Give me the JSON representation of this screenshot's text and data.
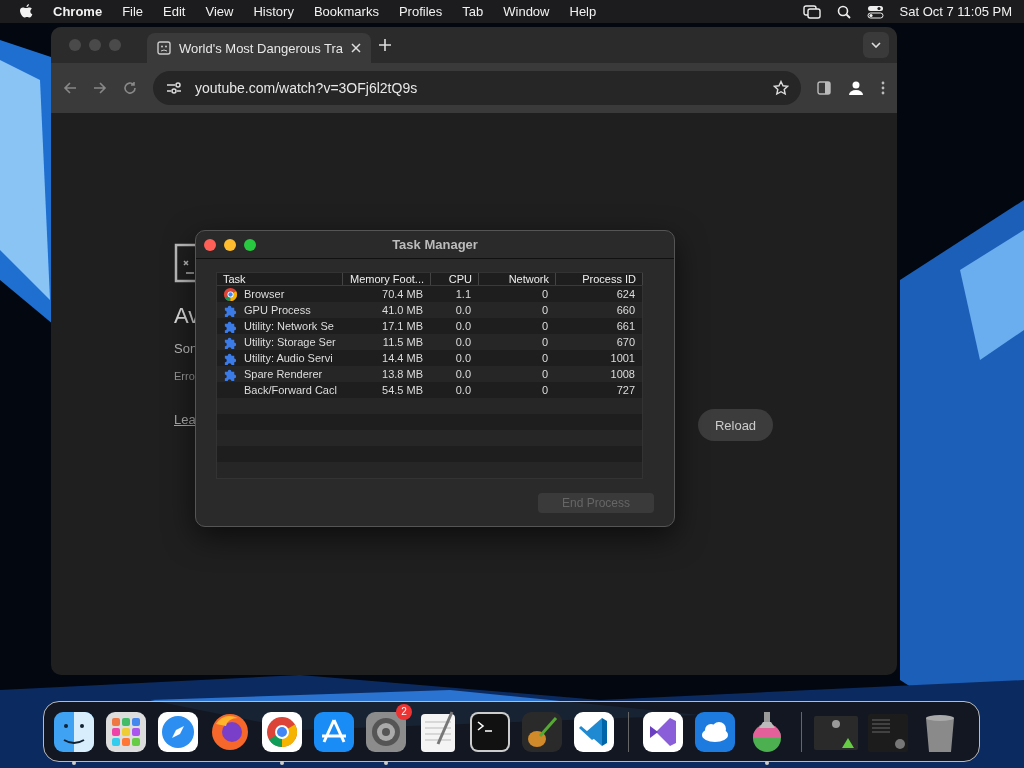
{
  "menu_bar": {
    "app_name": "Chrome",
    "menus": [
      "File",
      "Edit",
      "View",
      "History",
      "Bookmarks",
      "Profiles",
      "Tab",
      "Window",
      "Help"
    ],
    "clock": "Sat Oct 7  11:05 PM"
  },
  "browser": {
    "tabs": [
      {
        "title": "World's Most Dangerous Tra",
        "selected": true
      }
    ],
    "address": "youtube.com/watch?v=3OFj6l2tQ9s",
    "error_page": {
      "heading": "Av",
      "message": "Son",
      "error_code": "Erro",
      "link": "Lea",
      "reload_button": "Reload"
    }
  },
  "task_manager": {
    "title": "Task Manager",
    "columns": [
      "Task",
      "Memory Foot...",
      "CPU",
      "Network",
      "Process ID"
    ],
    "rows": [
      {
        "kind": "browser",
        "cells": [
          "Browser",
          "70.4 MB",
          "1.1",
          "0",
          "624"
        ]
      },
      {
        "kind": "extension",
        "cells": [
          "GPU Process",
          "41.0 MB",
          "0.0",
          "0",
          "660"
        ]
      },
      {
        "kind": "extension",
        "cells": [
          "Utility: Network Se",
          "17.1 MB",
          "0.0",
          "0",
          "661"
        ]
      },
      {
        "kind": "extension",
        "cells": [
          "Utility: Storage Ser",
          "11.5 MB",
          "0.0",
          "0",
          "670"
        ]
      },
      {
        "kind": "extension",
        "cells": [
          "Utility: Audio Servi",
          "14.4 MB",
          "0.0",
          "0",
          "1001"
        ]
      },
      {
        "kind": "extension",
        "cells": [
          "Spare Renderer",
          "13.8 MB",
          "0.0",
          "0",
          "1008"
        ]
      },
      {
        "kind": "plain",
        "cells": [
          "Back/Forward Cacl",
          "54.5 MB",
          "0.0",
          "0",
          "727"
        ]
      }
    ],
    "end_button": {
      "label": "End Process",
      "disabled": true
    }
  },
  "dock": [
    {
      "kind": "finder",
      "running": true
    },
    {
      "kind": "launchpad",
      "running": false
    },
    {
      "kind": "safari",
      "running": false
    },
    {
      "kind": "firefox",
      "running": false
    },
    {
      "kind": "chrome",
      "running": true
    },
    {
      "kind": "appstore",
      "running": false
    },
    {
      "kind": "settings",
      "running": true,
      "badge": "2"
    },
    {
      "kind": "textedit",
      "running": false
    },
    {
      "kind": "terminal",
      "running": false
    },
    {
      "kind": "guitar",
      "running": false
    },
    {
      "kind": "vscode",
      "running": false
    },
    {
      "kind": "divider"
    },
    {
      "kind": "visualstudio",
      "running": false
    },
    {
      "kind": "weather",
      "running": false
    },
    {
      "kind": "installer",
      "running": true
    },
    {
      "kind": "divider"
    },
    {
      "kind": "thumb",
      "running": false
    },
    {
      "kind": "thumb2",
      "running": false
    },
    {
      "kind": "trash",
      "running": false
    }
  ]
}
